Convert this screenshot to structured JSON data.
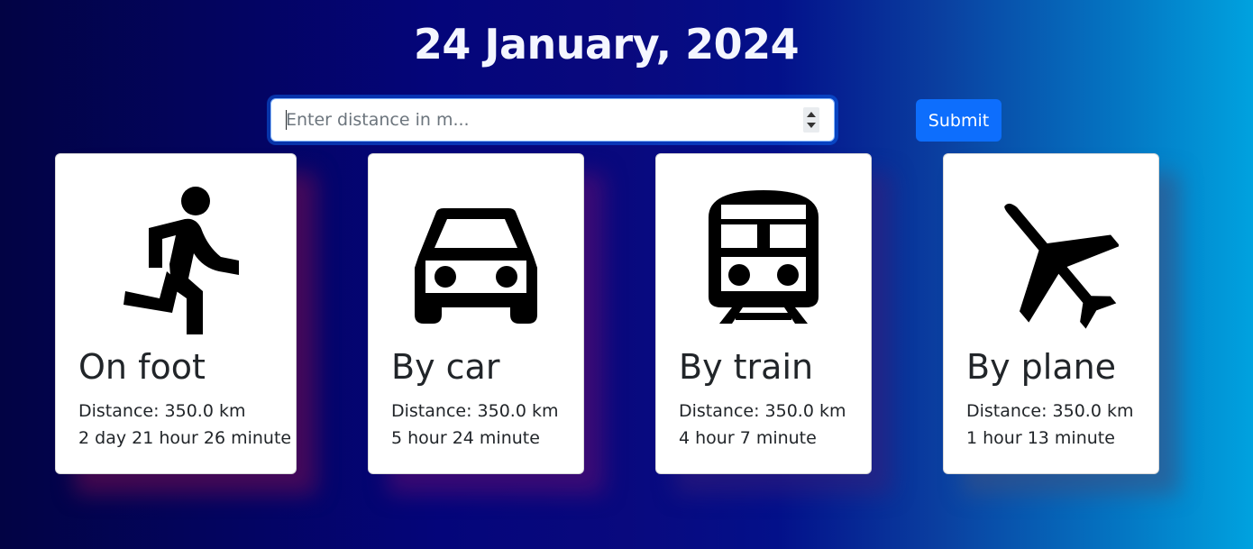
{
  "header": {
    "date": "24 January, 2024"
  },
  "form": {
    "placeholder": "Enter distance in m...",
    "value": "",
    "submit_label": "Submit"
  },
  "cards": [
    {
      "icon": "walking-icon",
      "title": "On foot",
      "distance": "Distance: 350.0 km",
      "time": "2 day 21 hour 26 minute"
    },
    {
      "icon": "car-icon",
      "title": "By car",
      "distance": "Distance: 350.0 km",
      "time": "5 hour 24 minute"
    },
    {
      "icon": "train-icon",
      "title": "By train",
      "distance": "Distance: 350.0 km",
      "time": "4 hour 7 minute"
    },
    {
      "icon": "plane-icon",
      "title": "By plane",
      "distance": "Distance: 350.0 km",
      "time": "1 hour 13 minute"
    }
  ],
  "colors": {
    "accent": "#0d6efd",
    "background_start": "#020344",
    "background_end": "#00a2df"
  }
}
